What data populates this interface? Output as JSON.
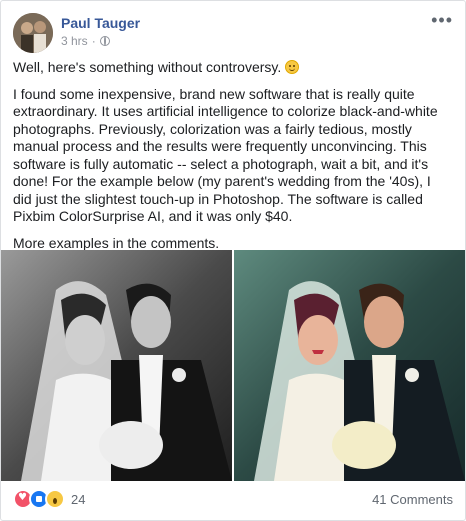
{
  "post": {
    "author": "Paul Tauger",
    "time": "3 hrs",
    "time_separator": "·",
    "visibility_icon": "globe-icon",
    "menu_label": "•••",
    "paragraphs": [
      "Well, here's something without controversy.",
      "I found some inexpensive, brand new software that is really quite extraordinary. It uses artificial intelligence to colorize black-and-white photographs. Previously, colorization was a fairly tedious, mostly manual process and the results were frequently unconvincing. This software is fully automatic -- select a photograph, wait a bit, and it's done! For the example below (my parent's wedding from the '40s), I did just the slightest touch-up in Photoshop. The software is called Pixbim ColorSurprise AI, and it was only $40.",
      "More examples in the comments."
    ]
  },
  "photos": {
    "left_desc": "black-and-white wedding photo",
    "right_desc": "colorized wedding photo"
  },
  "footer": {
    "reaction_icons": [
      "love-reaction-icon",
      "like-reaction-icon",
      "wow-reaction-icon"
    ],
    "reaction_count": "24",
    "comments": "41 Comments"
  },
  "colors": {
    "author_link": "#385898",
    "meta_gray": "#90949c",
    "like_blue": "#1877f2",
    "love_red": "#f25268",
    "wow_yellow": "#f7c843"
  }
}
